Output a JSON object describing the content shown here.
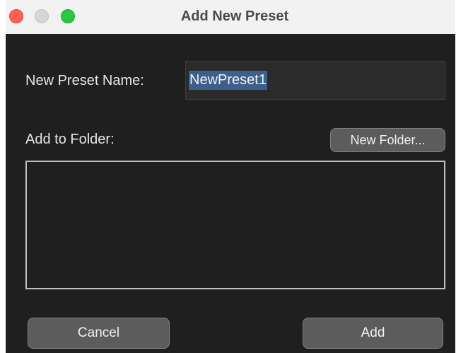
{
  "window": {
    "title": "Add New Preset"
  },
  "form": {
    "name_label": "New Preset Name:",
    "name_value": "NewPreset1",
    "folder_label": "Add to Folder:",
    "new_folder_label": "New Folder...",
    "folders": []
  },
  "actions": {
    "cancel_label": "Cancel",
    "add_label": "Add"
  },
  "colors": {
    "window_bg": "#1f1f1f",
    "titlebar_bg": "#f2f2f2",
    "button_bg": "#5c5c5c",
    "selection": "#3e5f8a"
  }
}
